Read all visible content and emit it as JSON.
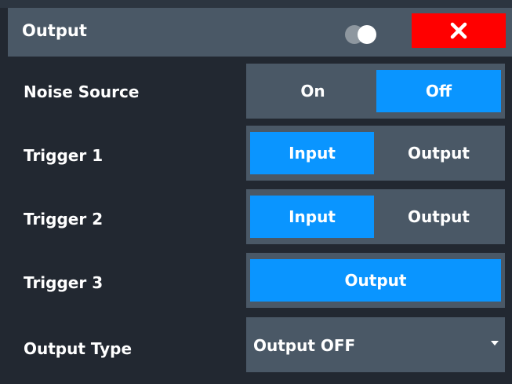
{
  "dialog": {
    "title": "Output",
    "close_icon": "close-x-icon",
    "toggle_icon": "two-circles-toggle-icon"
  },
  "colors": {
    "title_bg": "#4a5866",
    "body_bg": "#222831",
    "active": "#0a95ff",
    "close_bg": "#ff0000"
  },
  "rows": {
    "noise_source": {
      "label": "Noise Source",
      "options": [
        "On",
        "Off"
      ],
      "selected": "Off"
    },
    "trigger1": {
      "label": "Trigger 1",
      "options": [
        "Input",
        "Output"
      ],
      "selected": "Input"
    },
    "trigger2": {
      "label": "Trigger 2",
      "options": [
        "Input",
        "Output"
      ],
      "selected": "Input"
    },
    "trigger3": {
      "label": "Trigger 3",
      "value": "Output"
    },
    "output_type": {
      "label": "Output Type",
      "value": "Output OFF"
    }
  }
}
